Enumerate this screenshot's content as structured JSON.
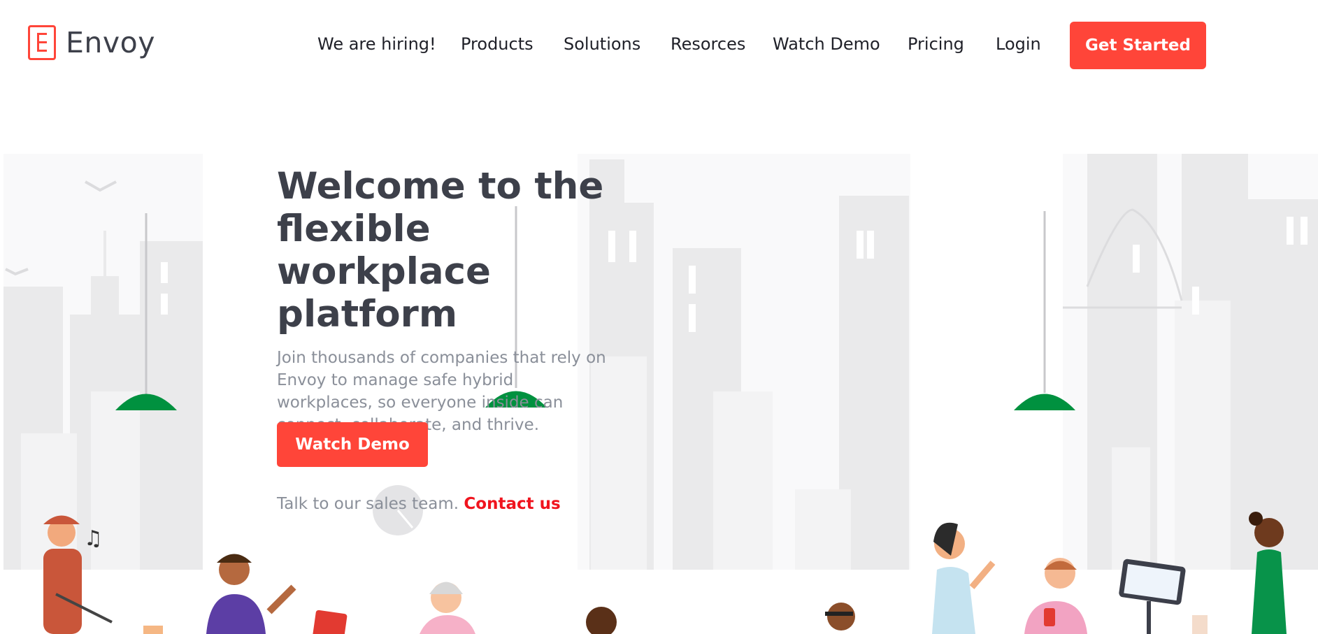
{
  "brand": {
    "name": "Envoy",
    "accent": "#ff4539"
  },
  "nav": {
    "items": [
      {
        "label": "We are hiring!"
      },
      {
        "label": "Products"
      },
      {
        "label": "Solutions"
      },
      {
        "label": "Resorces"
      },
      {
        "label": "Watch Demo"
      },
      {
        "label": "Pricing"
      },
      {
        "label": "Login"
      }
    ],
    "cta_label": "Get Started"
  },
  "hero": {
    "title_line1": "Welcome to the",
    "title_line2": "flexible workplace",
    "title_line3": "platform",
    "subtitle": "Join thousands of companies that rely on Envoy to manage safe hybrid workplaces, so everyone inside can connect, collaborate, and thrive.",
    "demo_button": "Watch Demo",
    "sales_text": "Talk to our sales team.",
    "sales_link": "Contact us"
  }
}
